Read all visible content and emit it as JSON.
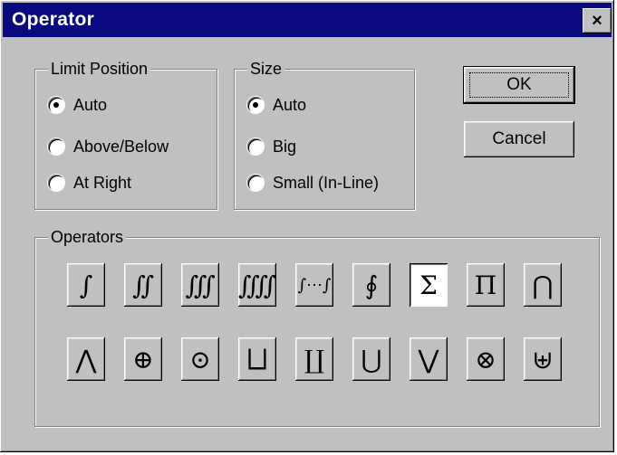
{
  "window": {
    "title": "Operator",
    "close_glyph": "×"
  },
  "limit_position": {
    "legend": "Limit Position",
    "options": [
      "Auto",
      "Above/Below",
      "At Right"
    ],
    "selected": "Auto"
  },
  "size": {
    "legend": "Size",
    "options": [
      "Auto",
      "Big",
      "Small (In-Line)"
    ],
    "selected": "Auto"
  },
  "buttons": {
    "ok": "OK",
    "cancel": "Cancel"
  },
  "operators": {
    "legend": "Operators",
    "row1": [
      {
        "glyph": "∫",
        "name": "integral-icon"
      },
      {
        "glyph": "∬",
        "name": "double-integral-icon"
      },
      {
        "glyph": "∭",
        "name": "triple-integral-icon"
      },
      {
        "glyph": "⨌",
        "name": "quadruple-integral-icon"
      },
      {
        "glyph": "∫⋯∫",
        "name": "multiple-integral-icon"
      },
      {
        "glyph": "∮",
        "name": "contour-integral-icon"
      },
      {
        "glyph": "Σ",
        "name": "summation-icon",
        "selected": true
      },
      {
        "glyph": "Π",
        "name": "product-icon"
      },
      {
        "glyph": "⋂",
        "name": "intersection-icon"
      }
    ],
    "row2": [
      {
        "glyph": "⋀",
        "name": "logical-and-icon"
      },
      {
        "glyph": "⊕",
        "name": "circled-plus-icon"
      },
      {
        "glyph": "⊙",
        "name": "circled-dot-icon"
      },
      {
        "glyph": "⨆",
        "name": "square-union-icon"
      },
      {
        "glyph": "∐",
        "name": "coproduct-icon"
      },
      {
        "glyph": "⋃",
        "name": "union-icon"
      },
      {
        "glyph": "⋁",
        "name": "logical-or-icon"
      },
      {
        "glyph": "⊗",
        "name": "circled-times-icon"
      },
      {
        "glyph": "⊎",
        "name": "multiset-union-icon"
      }
    ]
  }
}
